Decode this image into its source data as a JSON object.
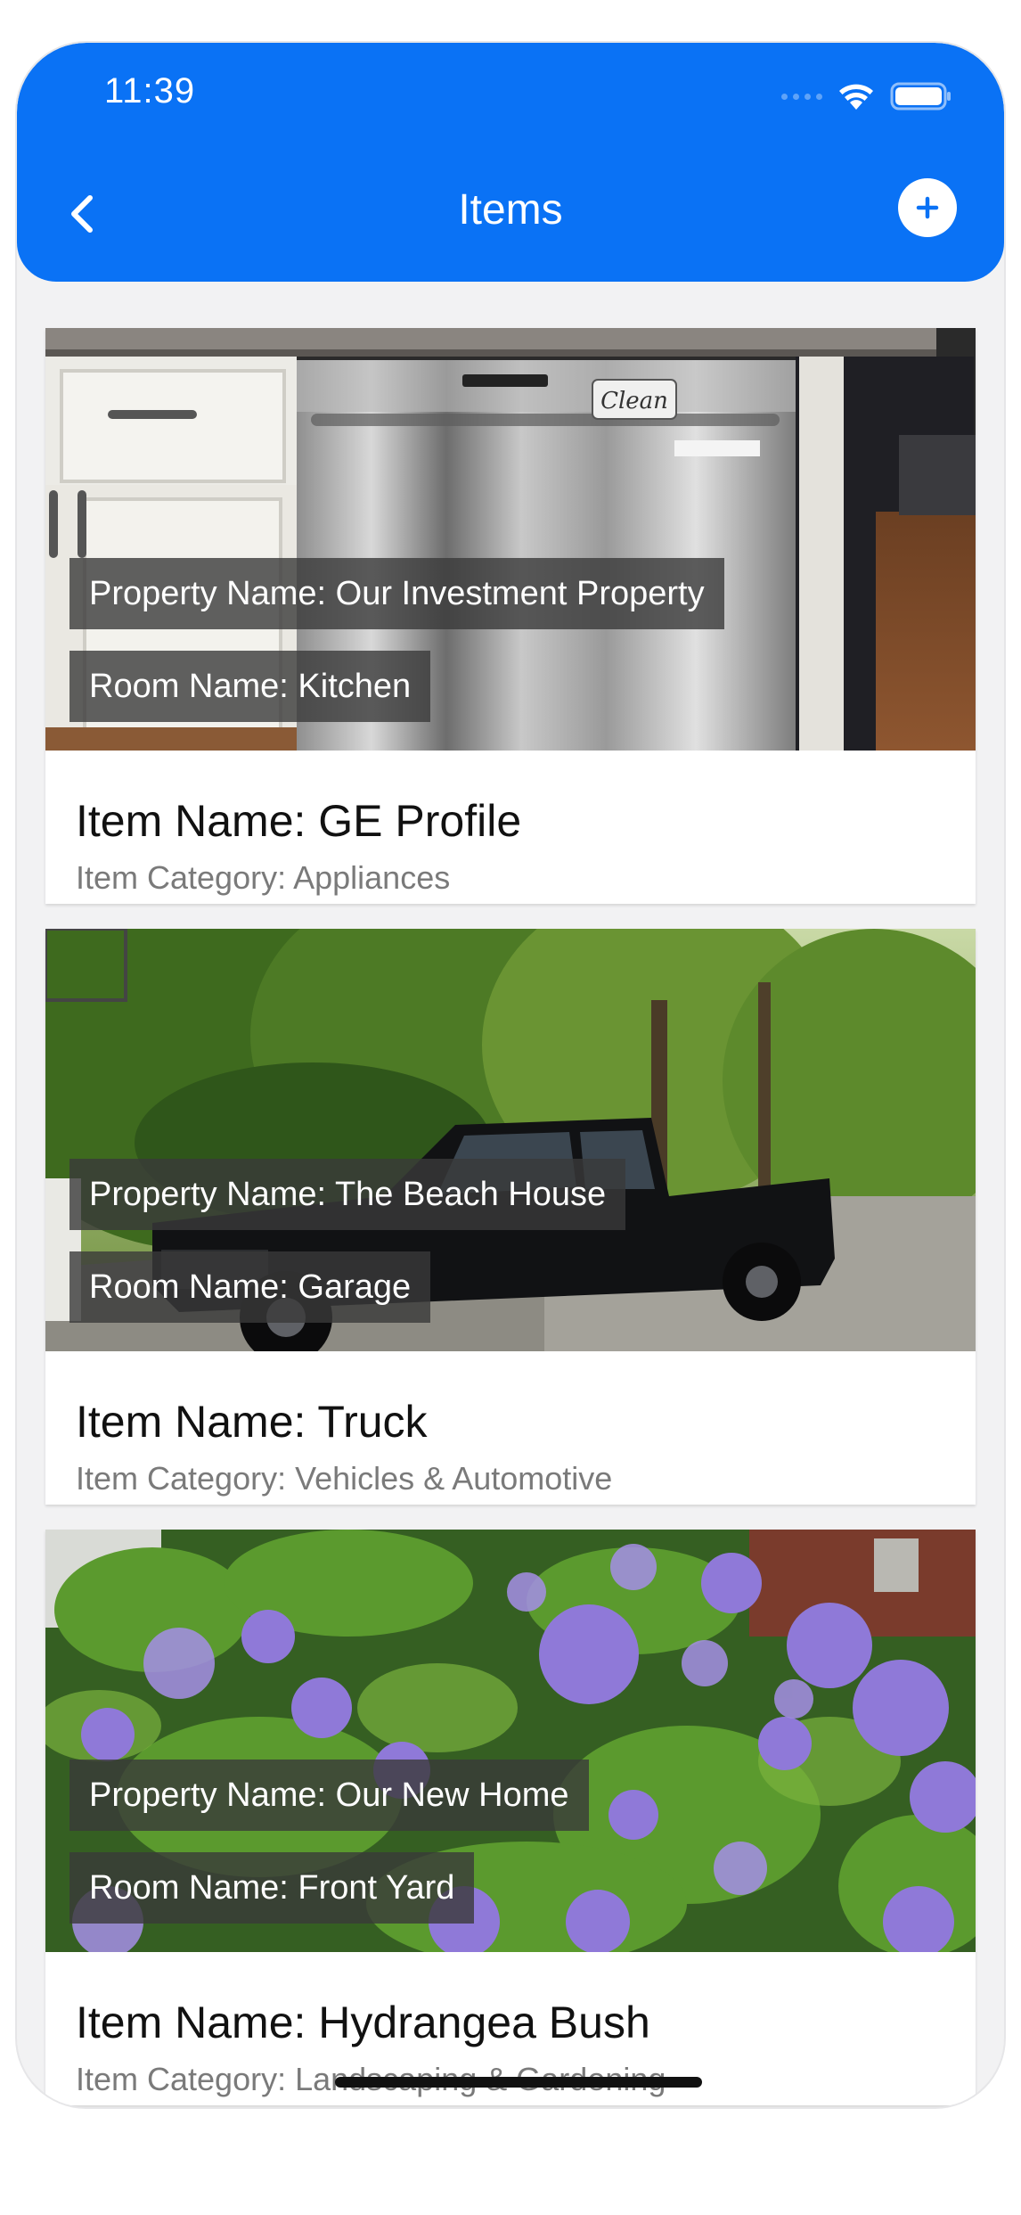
{
  "status_bar": {
    "time": "11:39"
  },
  "header": {
    "title": "Items"
  },
  "items": [
    {
      "property": "Property Name: Our Investment Property",
      "room": "Room Name: Kitchen",
      "name": "Item Name: GE Profile",
      "category": "Item Category: Appliances",
      "photo_text": "Clean"
    },
    {
      "property": "Property Name: The Beach House",
      "room": "Room Name: Garage",
      "name": "Item Name: Truck",
      "category": "Item Category: Vehicles & Automotive"
    },
    {
      "property": "Property Name: Our New Home",
      "room": "Room Name: Front Yard",
      "name": "Item Name: Hydrangea Bush",
      "category": "Item Category: Landscaping & Gardening"
    }
  ],
  "icons": {
    "back": "chevron-left-icon",
    "add": "plus-icon",
    "wifi": "wifi-icon",
    "battery": "battery-icon"
  },
  "colors": {
    "accent": "#0a72f5"
  }
}
